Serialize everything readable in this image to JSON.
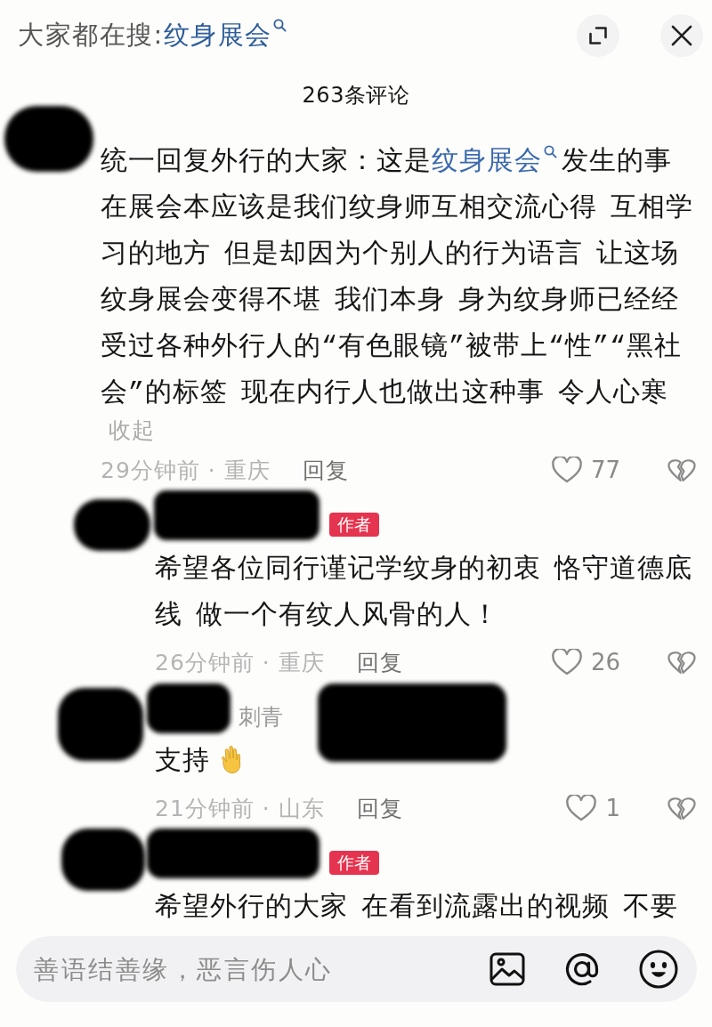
{
  "header": {
    "prompt": "大家都在搜:",
    "link": "纹身展会"
  },
  "title": "263条评论",
  "comments": [
    {
      "kind": "comment",
      "text_before": "统一回复外行的大家：这是",
      "link": "纹身展会",
      "text_after": "发生的事在展会本应该是我们纹身师互相交流心得 互相学习的地方 但是却因为个别人的行为语言 让这场纹身展会变得不堪 我们本身 身为纹身师已经经受过各种外行人的“有色眼镜”被带上“性”“黑社会”的标签 现在内行人也做出这种事 令人心寒",
      "collapse": "收起",
      "time_place": "29分钟前 · 重庆",
      "reply": "回复",
      "likes": "77",
      "liked": false
    },
    {
      "kind": "reply",
      "badge": "作者",
      "text": "希望各位同行谨记学纹身的初衷 恪守道德底线 做一个有纹人风骨的人！",
      "time_place": "26分钟前 · 重庆",
      "reply": "回复",
      "likes": "26",
      "liked": false
    },
    {
      "kind": "reply",
      "name": "刺青",
      "text": "支持",
      "emoji": true,
      "time_place": "21分钟前 · 山东",
      "reply": "回复",
      "likes": "1",
      "liked": false
    },
    {
      "kind": "reply",
      "badge": "作者",
      "text": "希望外行的大家 在看到流露出的视频 不要"
    }
  ],
  "comment_bar": {
    "placeholder": "善语结善缘，恶言伤人心"
  }
}
